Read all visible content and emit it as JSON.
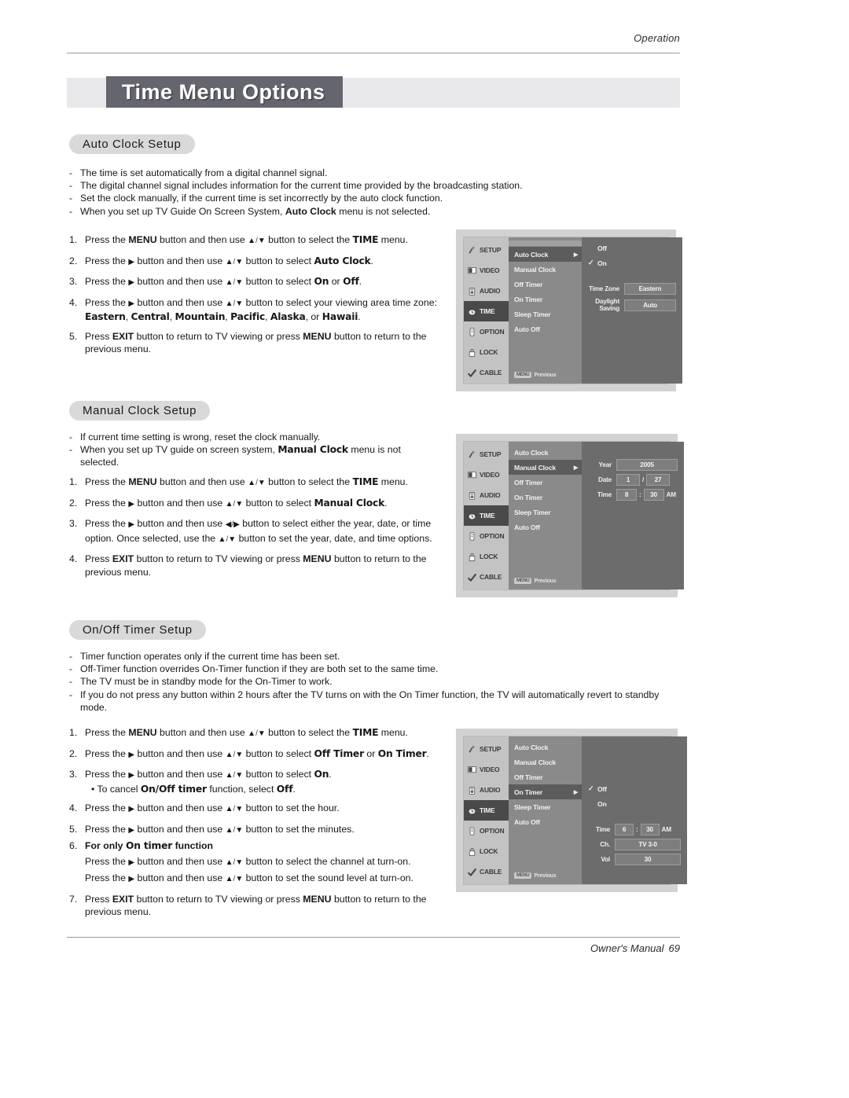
{
  "header": {
    "section_label": "Operation"
  },
  "title": {
    "text": "Time Menu Options"
  },
  "footer": {
    "manual_label": "Owner's Manual",
    "page_number": "69"
  },
  "sections": {
    "auto_clock": {
      "heading": "Auto Clock Setup",
      "bullets": [
        "The time is set automatically from a digital channel signal.",
        "The digital channel signal includes information for the current time provided by the broadcasting station.",
        "Set the clock manually, if the current time is set incorrectly by the auto clock function.",
        "When you set up TV Guide On Screen System, Auto Clock menu is not selected."
      ],
      "steps": {
        "s1": "1.",
        "s1_a": "Press the",
        "s1_b": "MENU",
        "s1_c": "button and then use",
        "s1_d": "button to select the",
        "s1_e": "TIME",
        "s1_f": "menu.",
        "s2": "2.",
        "s2_a": "Press the",
        "s2_c": "button and then use",
        "s2_d": "button to select",
        "s2_e": "Auto Clock",
        "s3": "3.",
        "s3_d": "button to select",
        "s3_on": "On",
        "s3_or": "or",
        "s3_off": "Off",
        "s4": "4.",
        "s4_d": "button to select your viewing area time zone:",
        "s4_zones": [
          "Eastern",
          "Central",
          "Mountain",
          "Pacific",
          "Alaska",
          "Hawaii"
        ],
        "s4_or": "or",
        "s5": "5.",
        "s5_a": "Press",
        "s5_exit": "EXIT",
        "s5_b": "button to return to TV viewing or press",
        "s5_menu": "MENU",
        "s5_c": "button to return to the previous menu."
      }
    },
    "manual_clock": {
      "heading": "Manual Clock Setup",
      "bullets": [
        "If current time setting is wrong, reset the clock manually.",
        "When you set up TV  guide on screen system, Manual Clock menu is not selected."
      ],
      "steps": {
        "s1": "1.",
        "s2": "2.",
        "s2_e": "Manual Clock",
        "s3": "3.",
        "s3_a": "Press the",
        "s3_b": "button and then use",
        "s3_c": "button to select either the year, date, or time option. Once selected, use the",
        "s3_d": "button to set the year, date, and time options.",
        "s4": "4."
      }
    },
    "on_off_timer": {
      "heading": "On/Off Timer Setup",
      "bullets": [
        "Timer function operates only if the current time has been set.",
        "Off-Timer function overrides On-Timer function if they are both set to the same time.",
        "The TV must be in standby mode for the On-Timer to work.",
        "If you do not press any button within 2 hours after the TV turns on with the On Timer function, the TV will automatically revert to standby mode."
      ],
      "steps": {
        "s1": "1.",
        "s2": "2.",
        "s2_off": "Off Timer",
        "s2_or": "or",
        "s2_on": "On Timer",
        "s3": "3.",
        "s3_d": "button to select",
        "s3_on": "On",
        "s3_bullet": "• To cancel",
        "s3_onoff": "On/Off timer",
        "s3_fn": "function, select",
        "s3_off": "Off",
        "s4": "4.",
        "s4_d": "button to set the hour.",
        "s5": "5.",
        "s5_d": "button to set the minutes.",
        "s6": "6.",
        "s6_head_a": "For only",
        "s6_head_b": "On timer",
        "s6_head_c": "function",
        "s6_l1": "button to select the channel at turn-on.",
        "s6_l2": "button to set the sound level at turn-on.",
        "s7": "7.",
        "s7_c": "button to return to the previous menu."
      }
    }
  },
  "common_step_text": {
    "press_the": "Press the",
    "menu": "MENU",
    "exit": "EXIT",
    "and_then_use": "button and then use",
    "button_to_select_the": "button to select the",
    "time_caps": "TIME",
    "menu_word": "menu.",
    "press": "Press",
    "exit_tail": "button to return to TV viewing or press",
    "menu_tail": "button to return to the previous menu."
  },
  "osd": {
    "sidebar": [
      {
        "label": "SETUP",
        "icon": "setup-icon",
        "selected": false
      },
      {
        "label": "VIDEO",
        "icon": "video-icon",
        "selected": false
      },
      {
        "label": "AUDIO",
        "icon": "audio-icon",
        "selected": false
      },
      {
        "label": "TIME",
        "icon": "time-icon",
        "selected": true
      },
      {
        "label": "OPTION",
        "icon": "option-icon",
        "selected": false
      },
      {
        "label": "LOCK",
        "icon": "lock-icon",
        "selected": false
      },
      {
        "label": "CABLE",
        "icon": "cable-icon",
        "selected": false
      }
    ],
    "menu_items": [
      "Auto Clock",
      "Manual Clock",
      "Off Timer",
      "On Timer",
      "Sleep Timer",
      "Auto Off"
    ],
    "previous_key": "MENU",
    "previous_label": "Previous",
    "screen1": {
      "selected_item": "Auto Clock",
      "options": [
        {
          "label": "Off",
          "checked": false
        },
        {
          "label": "On",
          "checked": true
        }
      ],
      "fields": [
        {
          "label": "Time Zone",
          "value": "Eastern"
        },
        {
          "label": "Daylight Saving",
          "value": "Auto"
        }
      ]
    },
    "screen2": {
      "selected_item": "Manual Clock",
      "year_label": "Year",
      "year_value": "2005",
      "date_label": "Date",
      "date_month": "1",
      "date_sep": "/",
      "date_day": "27",
      "time_label": "Time",
      "time_hour": "8",
      "time_sep": ":",
      "time_min": "30",
      "time_ampm": "AM"
    },
    "screen3": {
      "selected_item": "On Timer",
      "options": [
        {
          "label": "Off",
          "checked": true
        },
        {
          "label": "On",
          "checked": false
        }
      ],
      "time_label": "Time",
      "time_hour": "6",
      "time_sep": ":",
      "time_min": "30",
      "time_ampm": "AM",
      "ch_label": "Ch.",
      "ch_value": "TV 3-0",
      "vol_label": "Vol",
      "vol_value": "30"
    }
  },
  "glyphs": {
    "up": "▲",
    "down": "▼",
    "left": "◀",
    "right": "▶",
    "slash": "/",
    "check": "✓",
    "caret": "▶"
  },
  "colors": {
    "title_box": "#65656f",
    "title_band": "#e9e9eb",
    "pill": "#d9d9d9",
    "osd_frame": "#d2d2d2"
  }
}
